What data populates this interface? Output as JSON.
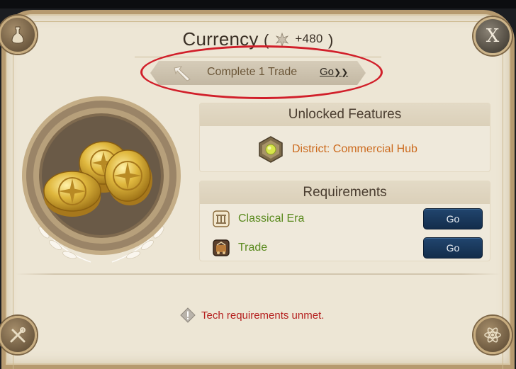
{
  "title": {
    "label": "Currency",
    "paren_open": "(",
    "reward_value": "+480",
    "paren_close": ")"
  },
  "quest": {
    "text": "Complete 1 Trade",
    "go_label": "Go",
    "go_chevrons": "❯❯"
  },
  "close_label": "X",
  "features": {
    "header": "Unlocked Features",
    "items": [
      {
        "label": "District: Commercial Hub",
        "icon": "commercial-hub-icon"
      }
    ]
  },
  "requirements": {
    "header": "Requirements",
    "items": [
      {
        "label": "Classical Era",
        "icon": "classical-era-icon",
        "button": "Go"
      },
      {
        "label": "Trade",
        "icon": "trade-icon",
        "button": "Go"
      }
    ]
  },
  "warning": {
    "text": "Tech requirements unmet.",
    "icon": "warning-icon"
  },
  "colors": {
    "feature_text": "#cc6a1d",
    "requirement_text": "#5a8a1e",
    "warning_text": "#b5201f",
    "go_button": "#1b3b60",
    "highlight": "#d11f2a"
  }
}
